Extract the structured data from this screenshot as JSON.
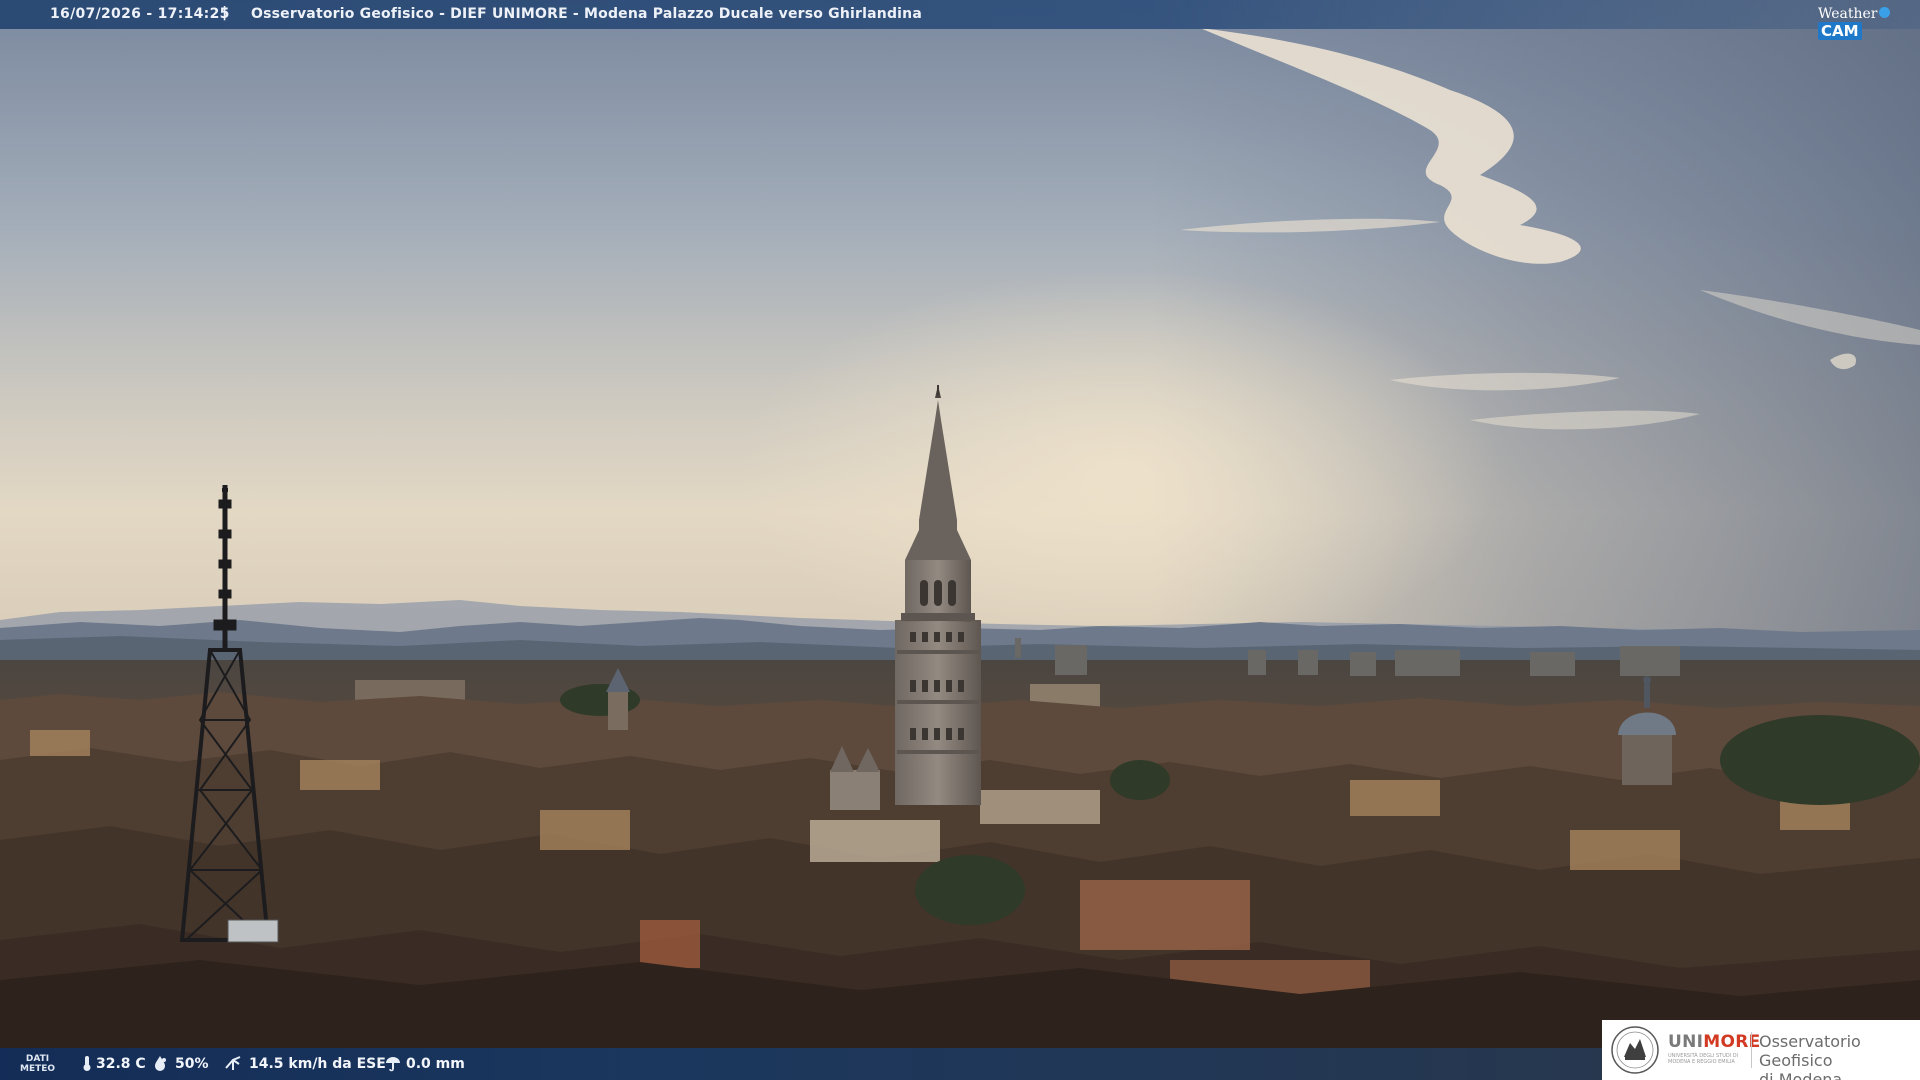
{
  "overlay": {
    "timestamp": "16/07/2026 - 17:14:25",
    "separator": "|",
    "camera_title": "Osservatorio Geofisico - DIEF UNIMORE - Modena Palazzo Ducale verso Ghirlandina",
    "brand": {
      "weather": "Weather",
      "cam": "CAM"
    }
  },
  "meteo": {
    "label_line1": "DATI",
    "label_line2": "METEO",
    "temperature": "32.8 C",
    "humidity": "50%",
    "wind": "14.5 km/h da ESE",
    "rain": "0.0 mm",
    "icons": [
      "thermometer-icon",
      "humidity-drop-icon",
      "wind-icon",
      "rain-gauge-icon"
    ]
  },
  "logo": {
    "uni_part1": "UNI",
    "uni_part2": "MORE",
    "uni_subtitle": "UNIVERSITÀ DEGLI STUDI DI MODENA E REGGIO EMILIA",
    "observatory_line1": "Osservatorio Geofisico",
    "observatory_line2": "di Modena"
  },
  "colors": {
    "sky_top": "#7f8da3",
    "sky_horizon": "#e2d6c2",
    "cloud": "#e9e0cf",
    "roofs": "#4a3a30",
    "bar_blue": "#24447a",
    "unimore_red": "#d23a23"
  }
}
